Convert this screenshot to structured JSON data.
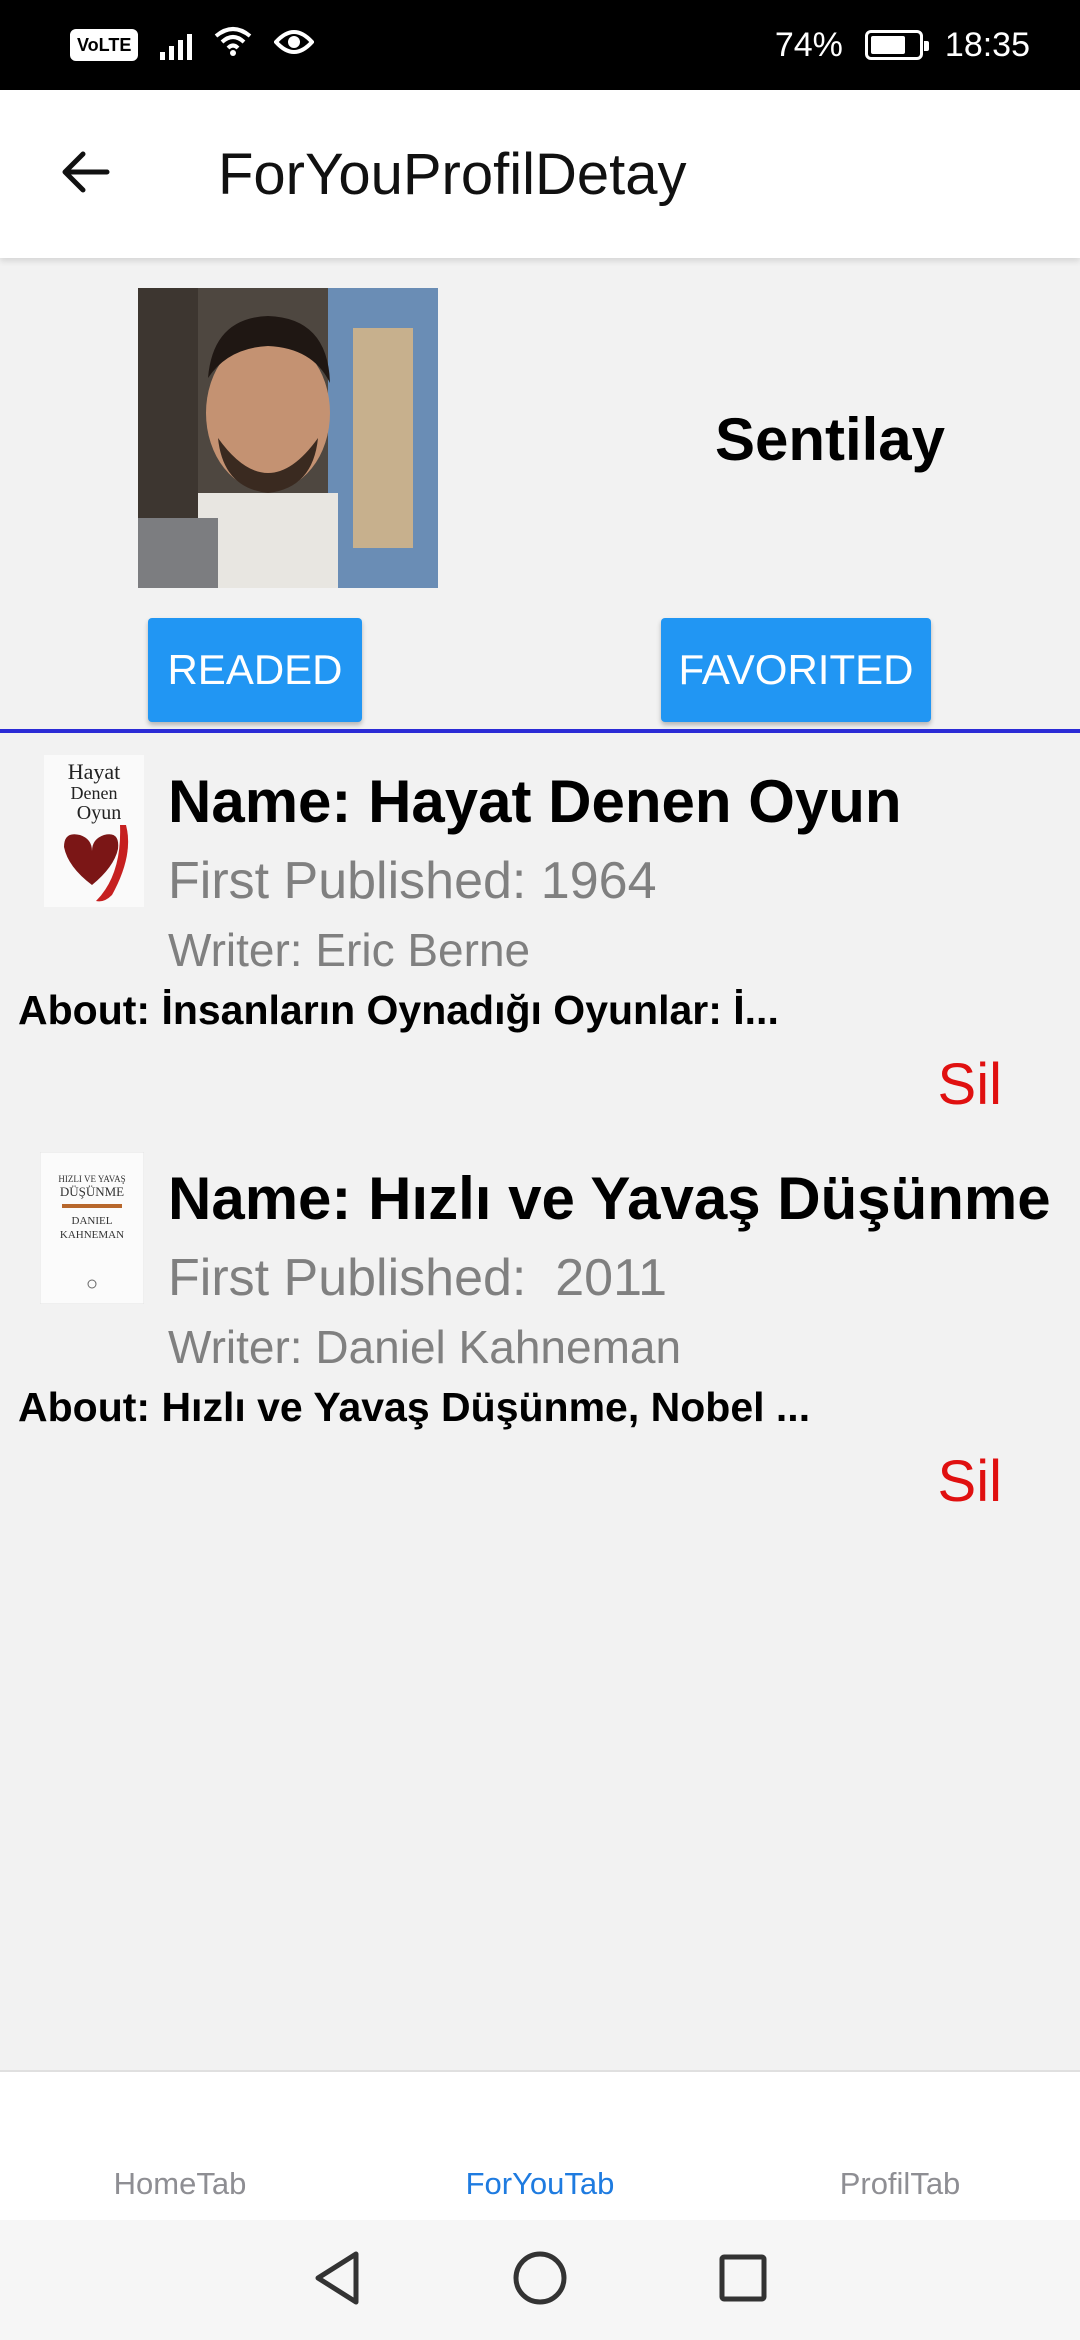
{
  "status_bar": {
    "volte": "VoLTE",
    "battery_percent": "74%",
    "time": "18:35",
    "battery_level": 0.74
  },
  "app_bar": {
    "title": "ForYouProfilDetay",
    "back_icon": "arrow-left-icon"
  },
  "profile": {
    "name": "Sentilay",
    "readed_label": "READED",
    "favorited_label": "FAVORITED"
  },
  "books": [
    {
      "cover_text": [
        "Hayat",
        "Denen",
        "Oyun"
      ],
      "name": "Name: Hayat Denen Oyun",
      "published": "First Published: 1964",
      "writer": "Writer: Eric Berne",
      "about": "About: İnsanların Oynadığı Oyunlar: İ...",
      "delete_label": "Sil"
    },
    {
      "cover_text": [
        "HIZLI VE YAVAŞ",
        "DÜŞÜNME",
        "DANIEL",
        "KAHNEMAN"
      ],
      "name": "Name: Hızlı ve Yavaş Düşünme",
      "published": "First Published:  2011",
      "writer": "Writer: Daniel Kahneman",
      "about": "About: Hızlı ve Yavaş Düşünme, Nobel ...",
      "delete_label": "Sil"
    }
  ],
  "tabs": [
    {
      "label": "HomeTab",
      "active": false
    },
    {
      "label": "ForYouTab",
      "active": true
    },
    {
      "label": "ProfilTab",
      "active": false
    }
  ],
  "colors": {
    "primary_button": "#2196f3",
    "delete_text": "#e01010",
    "active_tab": "#1e7be0",
    "divider": "#2b2bd6"
  }
}
